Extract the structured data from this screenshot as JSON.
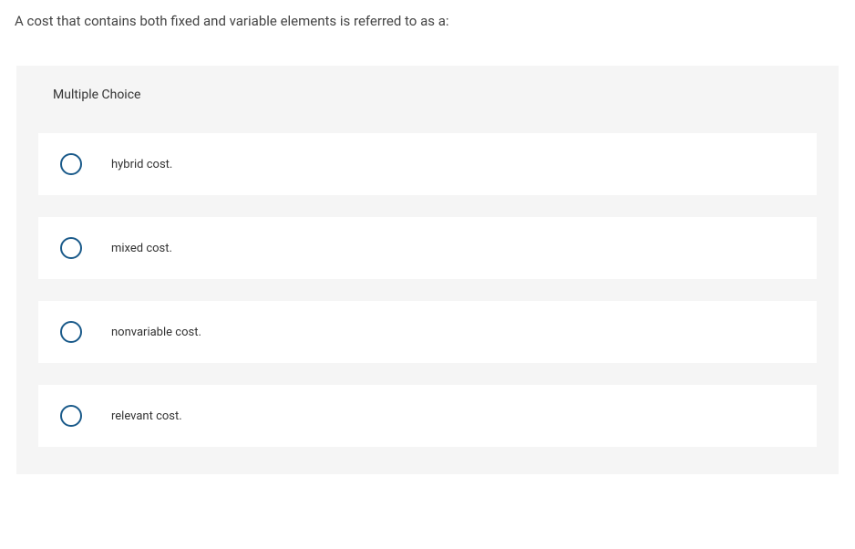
{
  "question": {
    "text": "A cost that contains both fixed and variable elements is referred to as a:",
    "type_label": "Multiple Choice",
    "options": [
      {
        "label": "hybrid cost."
      },
      {
        "label": "mixed cost."
      },
      {
        "label": "nonvariable cost."
      },
      {
        "label": "relevant cost."
      }
    ]
  }
}
